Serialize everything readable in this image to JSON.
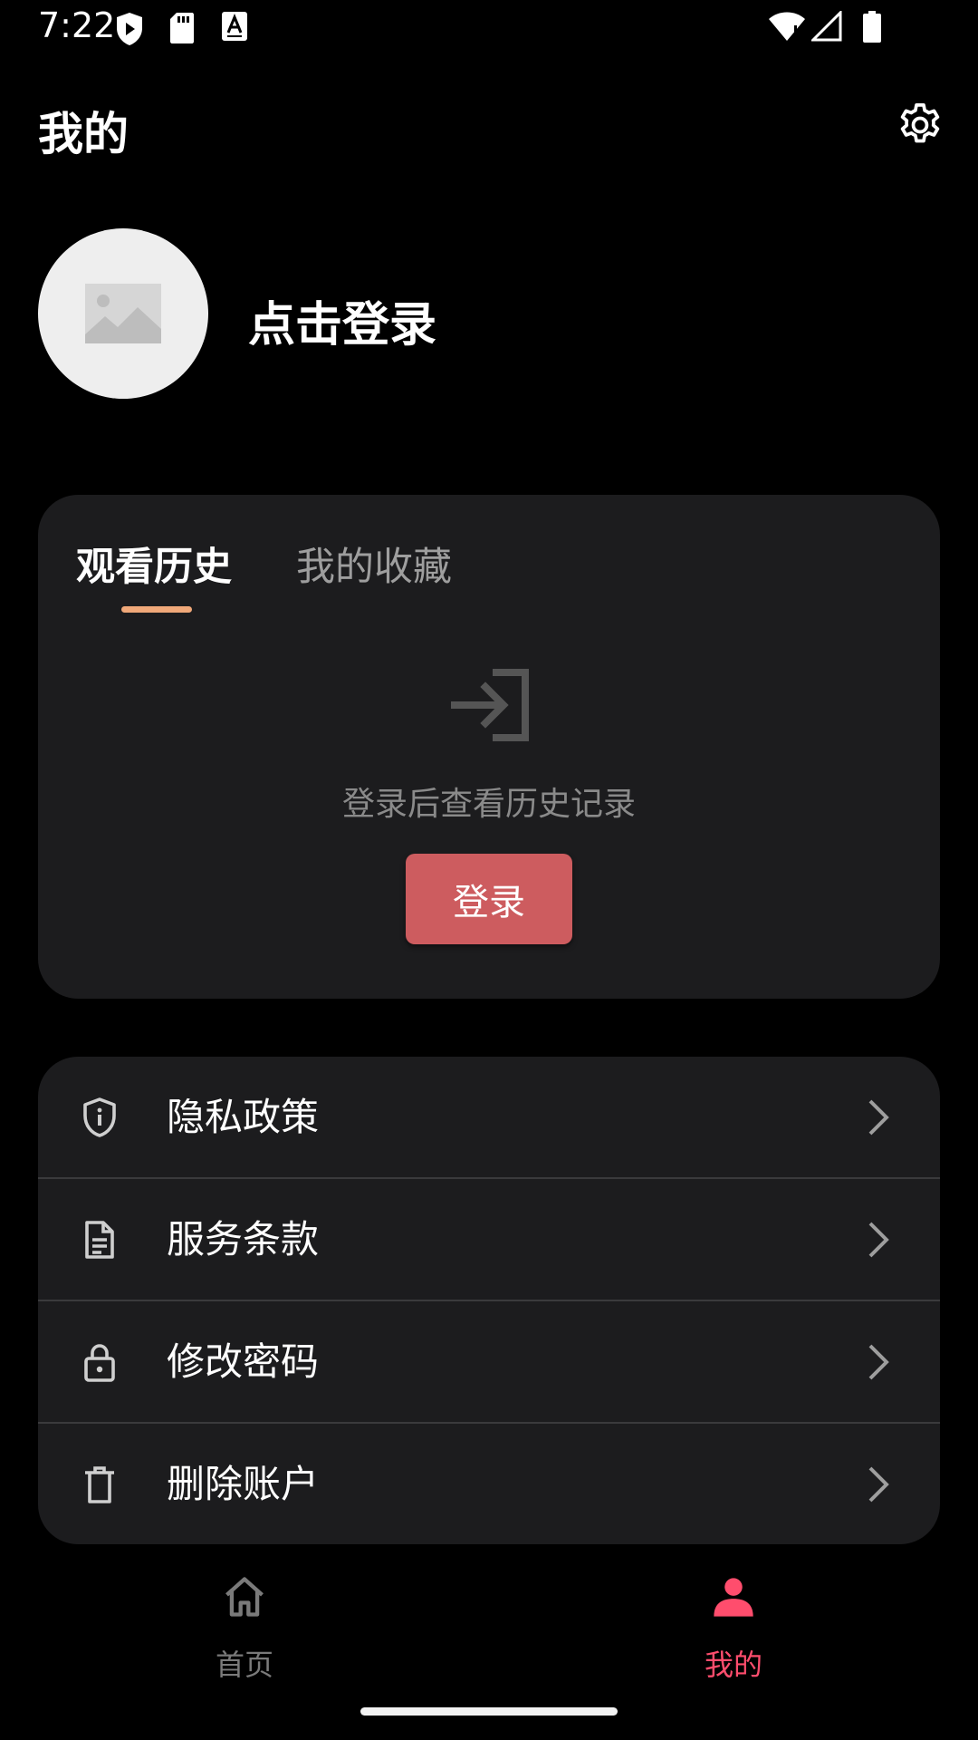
{
  "status_bar": {
    "time": "7:22",
    "icons_left": [
      "shield-play-icon",
      "sd-card-icon",
      "a-keyboard-icon"
    ],
    "icons_right": [
      "wifi-icon",
      "signal-icon",
      "battery-icon"
    ]
  },
  "header": {
    "title": "我的",
    "settings_icon": "gear-icon"
  },
  "profile": {
    "avatar_icon": "image-placeholder-icon",
    "login_prompt": "点击登录"
  },
  "history_card": {
    "tabs": [
      {
        "label": "观看历史",
        "selected": true
      },
      {
        "label": "我的收藏",
        "selected": false
      }
    ],
    "empty_icon": "login-arrow-icon",
    "empty_text": "登录后查看历史记录",
    "login_button": "登录"
  },
  "menu": {
    "items": [
      {
        "label": "隐私政策",
        "icon": "shield-info-icon"
      },
      {
        "label": "服务条款",
        "icon": "document-icon"
      },
      {
        "label": "修改密码",
        "icon": "lock-icon"
      },
      {
        "label": "删除账户",
        "icon": "trash-icon"
      }
    ]
  },
  "bottom_nav": {
    "items": [
      {
        "label": "首页",
        "icon": "home-icon",
        "active": false
      },
      {
        "label": "我的",
        "icon": "person-icon",
        "active": true
      }
    ]
  },
  "colors": {
    "background": "#000000",
    "card": "#1c1c1e",
    "accent_button": "#cd5c5f",
    "active_nav": "#ff4d6d",
    "tab_indicator": "#f0a879"
  }
}
